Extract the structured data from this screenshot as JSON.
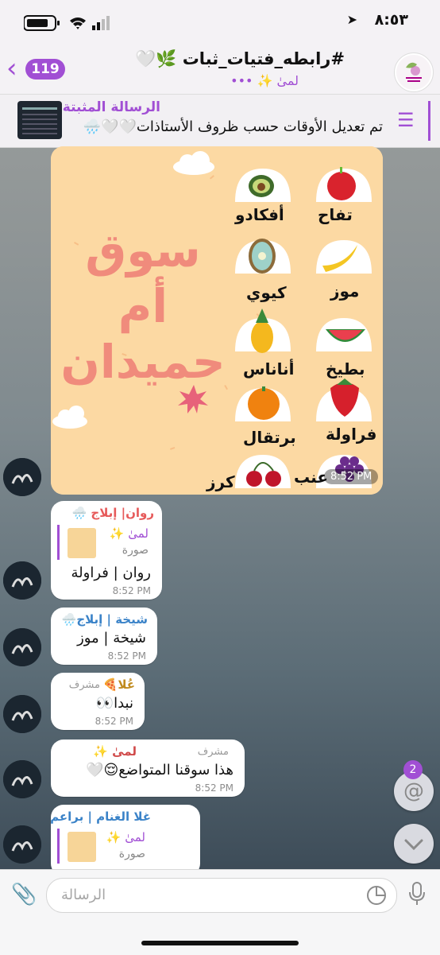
{
  "status": {
    "time": "٨:٥٣"
  },
  "header": {
    "back_count": "119",
    "title": "#رابطه_فتيات_ثبات 🌿🤍",
    "subtitle": "لمىٰ ✨ •••"
  },
  "pinned": {
    "label": "الرسالة المثبتة",
    "text": "تم تعديل الأوقات حسب ظروف الأستاذات🤍🤍🌧️"
  },
  "image_card": {
    "headline_line1": "سوق أم",
    "headline_line2": "حميدان",
    "fruits": [
      "تفاح",
      "أفكادو",
      "موز",
      "كيوي",
      "بطيخ",
      "أناناس",
      "فراولة",
      "برتقال",
      "عنب",
      "كرز"
    ],
    "time": "8:52 PM"
  },
  "messages": [
    {
      "sender": "روان| إبلاج 🌧️",
      "reply_name": "لمىٰ ✨",
      "reply_sub": "صورة",
      "text": "روان | فراولة",
      "time": "8:52 PM"
    },
    {
      "sender": "شيخة | إبلاج🌧️",
      "text": "شيخة | موز",
      "time": "8:52 PM"
    },
    {
      "sender": "عُلا🍕",
      "admin": "مشرف",
      "text": "نبدا👀",
      "time": "8:52 PM"
    },
    {
      "sender": "لمىٰ ✨",
      "admin": "مشرف",
      "text": "هذا سوقنا المتواضع😌🤍",
      "time": "8:52 PM"
    },
    {
      "sender": "غلا الغنام | براعم",
      "reply_name": "لمىٰ ✨",
      "reply_sub": "صورة"
    }
  ],
  "mentions_badge": "2",
  "input": {
    "placeholder": "الرسالة"
  },
  "colors": {
    "accent": "#a14fd4",
    "card_bg": "#fcd9a3"
  }
}
